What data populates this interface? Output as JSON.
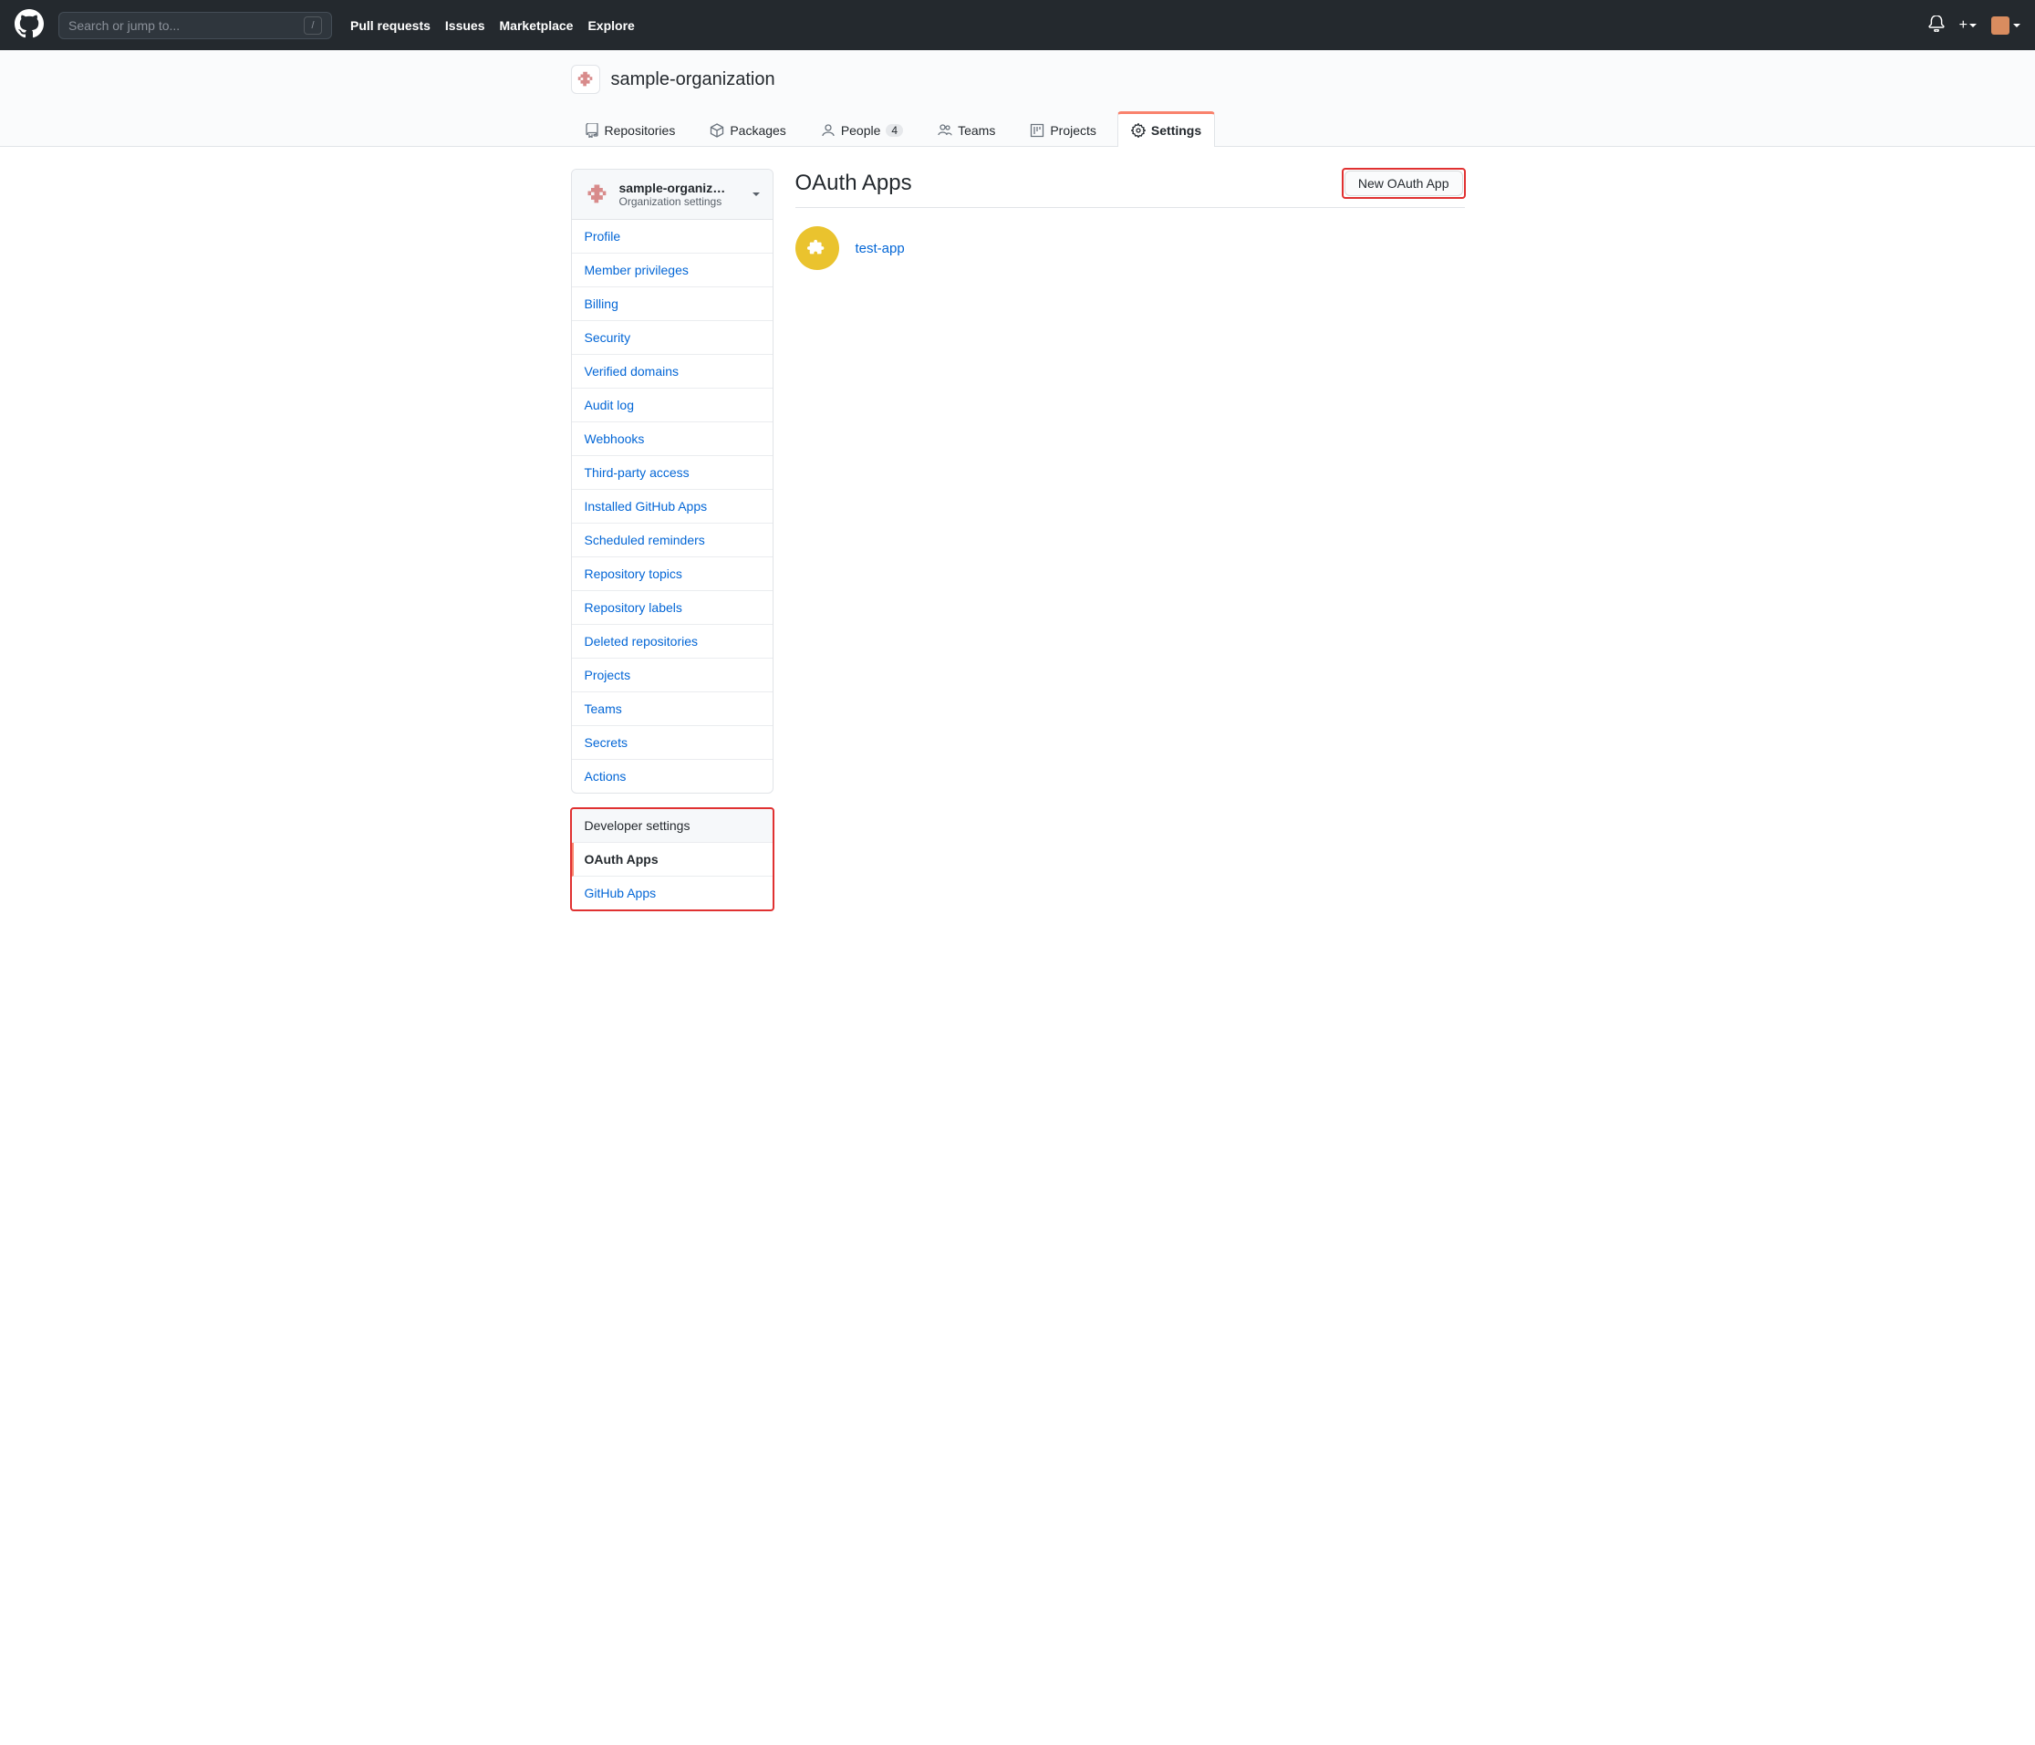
{
  "header": {
    "search_placeholder": "Search or jump to...",
    "slash": "/",
    "nav": [
      "Pull requests",
      "Issues",
      "Marketplace",
      "Explore"
    ]
  },
  "org": {
    "name": "sample-organization"
  },
  "tabs": [
    {
      "label": "Repositories"
    },
    {
      "label": "Packages"
    },
    {
      "label": "People",
      "count": "4"
    },
    {
      "label": "Teams"
    },
    {
      "label": "Projects"
    },
    {
      "label": "Settings",
      "selected": true
    }
  ],
  "sidebar": {
    "switcher_name": "sample-organizat...",
    "switcher_sub": "Organization settings",
    "items": [
      "Profile",
      "Member privileges",
      "Billing",
      "Security",
      "Verified domains",
      "Audit log",
      "Webhooks",
      "Third-party access",
      "Installed GitHub Apps",
      "Scheduled reminders",
      "Repository topics",
      "Repository labels",
      "Deleted repositories",
      "Projects",
      "Teams",
      "Secrets",
      "Actions"
    ],
    "dev_heading": "Developer settings",
    "dev_items": [
      "OAuth Apps",
      "GitHub Apps"
    ],
    "dev_active": "OAuth Apps"
  },
  "page": {
    "title": "OAuth Apps",
    "new_button": "New OAuth App",
    "apps": [
      {
        "name": "test-app"
      }
    ]
  }
}
